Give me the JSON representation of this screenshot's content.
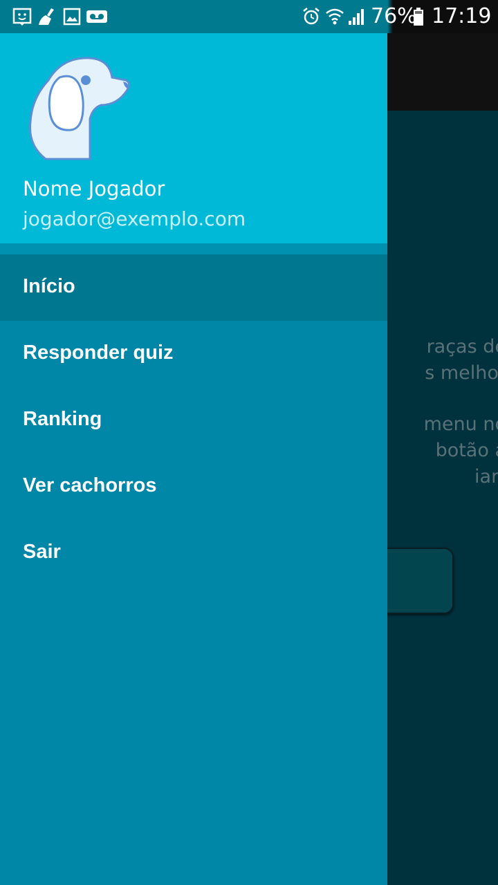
{
  "status_bar": {
    "battery_percent": "76%",
    "time": "17:19",
    "icons": [
      "smiley-face-icon",
      "broom-icon",
      "image-icon",
      "voicemail-icon",
      "alarm-icon",
      "wifi-icon",
      "signal-icon",
      "battery-icon"
    ]
  },
  "drawer": {
    "user_name": "Nome Jogador",
    "user_email": "jogador@exemplo.com",
    "menu": [
      {
        "label": "Início",
        "selected": true
      },
      {
        "label": "Responder quiz",
        "selected": false
      },
      {
        "label": "Ranking",
        "selected": false
      },
      {
        "label": "Ver cachorros",
        "selected": false
      },
      {
        "label": "Sair",
        "selected": false
      }
    ]
  },
  "background": {
    "text_lines": [
      "raças de",
      "s melhor",
      "menu no",
      "botão a",
      "iar!"
    ]
  },
  "colors": {
    "drawer_header": "#00b9d7",
    "drawer_body": "#0087a7",
    "selected_item": "#007790",
    "background_app": "#003340"
  }
}
